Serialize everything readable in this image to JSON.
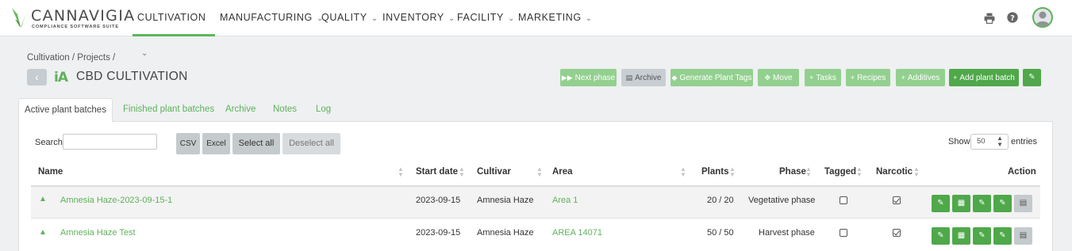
{
  "app": {
    "brand_name": "CANNAVIGIA",
    "brand_tagline": "COMPLIANCE SOFTWARE SUITE",
    "accent_color": "#5fb15c"
  },
  "nav": {
    "items": [
      {
        "label": "CULTIVATION",
        "active": true
      },
      {
        "label": "MANUFACTURING"
      },
      {
        "label": "QUALITY"
      },
      {
        "label": "INVENTORY"
      },
      {
        "label": "FACILITY"
      },
      {
        "label": "MARKETING"
      }
    ],
    "right_icons": [
      "print-icon",
      "help-icon",
      "user-avatar-icon"
    ]
  },
  "breadcrumb": "Cultivation / Projects /",
  "page": {
    "title_icon": "iA",
    "title": "CBD CULTIVATION"
  },
  "actions": {
    "next_phase": "Next phase",
    "archive": "Archive",
    "generate_plant_tags": "Generate Plant Tags",
    "move": "Move",
    "tasks": "Tasks",
    "recipes": "Recipes",
    "additives": "Additives",
    "add_plant_batch": "Add plant batch"
  },
  "tabs": [
    {
      "label": "Active plant batches",
      "active": true
    },
    {
      "label": "Finished plant batches"
    },
    {
      "label": "Archive"
    },
    {
      "label": "Notes"
    },
    {
      "label": "Log"
    }
  ],
  "toolbar": {
    "search_label": "Search",
    "search_value": "",
    "csv": "CSV",
    "excel": "Excel",
    "select_all": "Select all",
    "deselect_all": "Deselect all",
    "show_label": "Show",
    "page_size": "50",
    "entries_label": "entries"
  },
  "table": {
    "columns": [
      "Name",
      "Start date",
      "Cultivar",
      "Area",
      "Plants",
      "Phase",
      "Tagged",
      "Narcotic",
      "Action"
    ],
    "rows": [
      {
        "name": "Amnesia Haze-2023-09-15-1",
        "start_date": "2023-09-15",
        "cultivar": "Amnesia Haze",
        "area": "Area 1",
        "plants": "20 / 20",
        "phase": "Vegetative phase",
        "tagged": false,
        "narcotic": true
      },
      {
        "name": "Amnesia Haze Test",
        "start_date": "2023-09-15",
        "cultivar": "Amnesia Haze",
        "area": "AREA 14071",
        "plants": "50 / 50",
        "phase": "Harvest phase",
        "tagged": false,
        "narcotic": true
      }
    ]
  }
}
